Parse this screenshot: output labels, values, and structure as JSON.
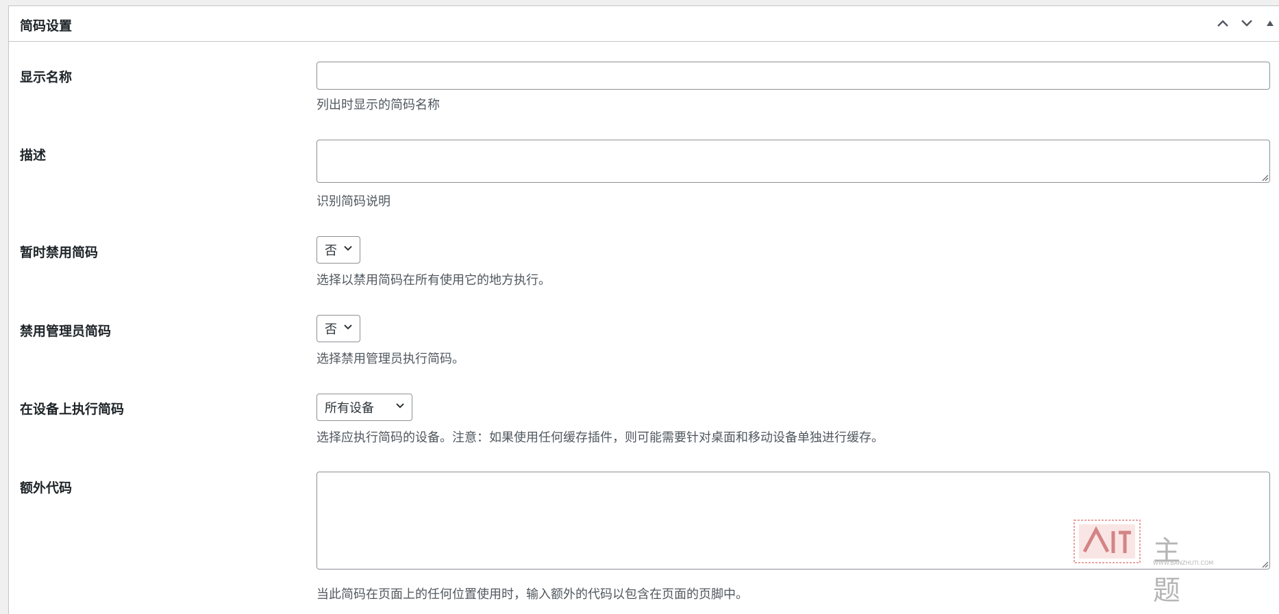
{
  "panel": {
    "title": "简码设置"
  },
  "header_controls": [
    "move-up",
    "move-down",
    "toggle-panel"
  ],
  "fields": {
    "display_name": {
      "label": "显示名称",
      "value": "",
      "description": "列出时显示的简码名称"
    },
    "description": {
      "label": "描述",
      "value": "",
      "description": "识别简码说明"
    },
    "disable_temp": {
      "label": "暂时禁用简码",
      "selected": "否",
      "description": "选择以禁用简码在所有使用它的地方执行。"
    },
    "disable_admin": {
      "label": "禁用管理员简码",
      "selected": "否",
      "description": "选择禁用管理员执行简码。"
    },
    "devices": {
      "label": "在设备上执行简码",
      "selected": "所有设备",
      "description": "选择应执行简码的设备。注意：如果使用任何缓存插件，则可能需要针对桌面和移动设备单独进行缓存。"
    },
    "extra_code": {
      "label": "额外代码",
      "value": "",
      "description": "当此简码在页面上的任何位置使用时，输入额外的代码以包含在页面的页脚中。"
    }
  },
  "watermark": {
    "main": "主题",
    "url": "WWW.BANZHUTI.COM"
  },
  "colors": {
    "border": "#8c8f94",
    "panel_border": "#c3c4c7",
    "desc_text": "#50575e",
    "watermark_red": "#d9534f"
  }
}
